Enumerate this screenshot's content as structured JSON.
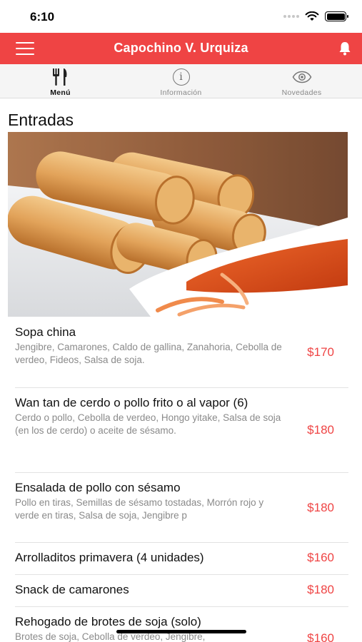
{
  "status_bar": {
    "time": "6:10"
  },
  "header": {
    "title": "Capochino V. Urquiza"
  },
  "tabs": [
    {
      "label": "Menú",
      "icon": "cutlery-icon",
      "active": true
    },
    {
      "label": "Información",
      "icon": "info-icon",
      "active": false
    },
    {
      "label": "Novedades",
      "icon": "eye-icon",
      "active": false
    }
  ],
  "section": {
    "title": "Entradas"
  },
  "colors": {
    "accent": "#ef4444",
    "price": "#ef4444"
  },
  "items": [
    {
      "name": "Sopa china",
      "description": "Jengibre, Camarones, Caldo de gallina, Zanahoria, Cebolla de verdeo, Fideos, Salsa de soja.",
      "price": "$170"
    },
    {
      "name": "Wan tan de cerdo o pollo frito o al vapor (6)",
      "description": "Cerdo o pollo, Cebolla de verdeo, Hongo yitake, Salsa de soja (en los de cerdo) o aceite de sésamo.",
      "price": "$180"
    },
    {
      "name": "Ensalada de pollo con sésamo",
      "description": "Pollo en tiras, Semillas de sésamo tostadas, Morrón rojo y verde en tiras, Salsa de soja, Jengibre p",
      "price": "$180"
    },
    {
      "name": "Arrolladitos primavera (4 unidades)",
      "description": "",
      "price": "$160"
    },
    {
      "name": "Snack de camarones",
      "description": "",
      "price": "$180"
    },
    {
      "name": "Rehogado de brotes de soja (solo)",
      "description": "Brotes de soja, Cebolla de verdeo, Jengibre,",
      "price": "$160"
    }
  ]
}
